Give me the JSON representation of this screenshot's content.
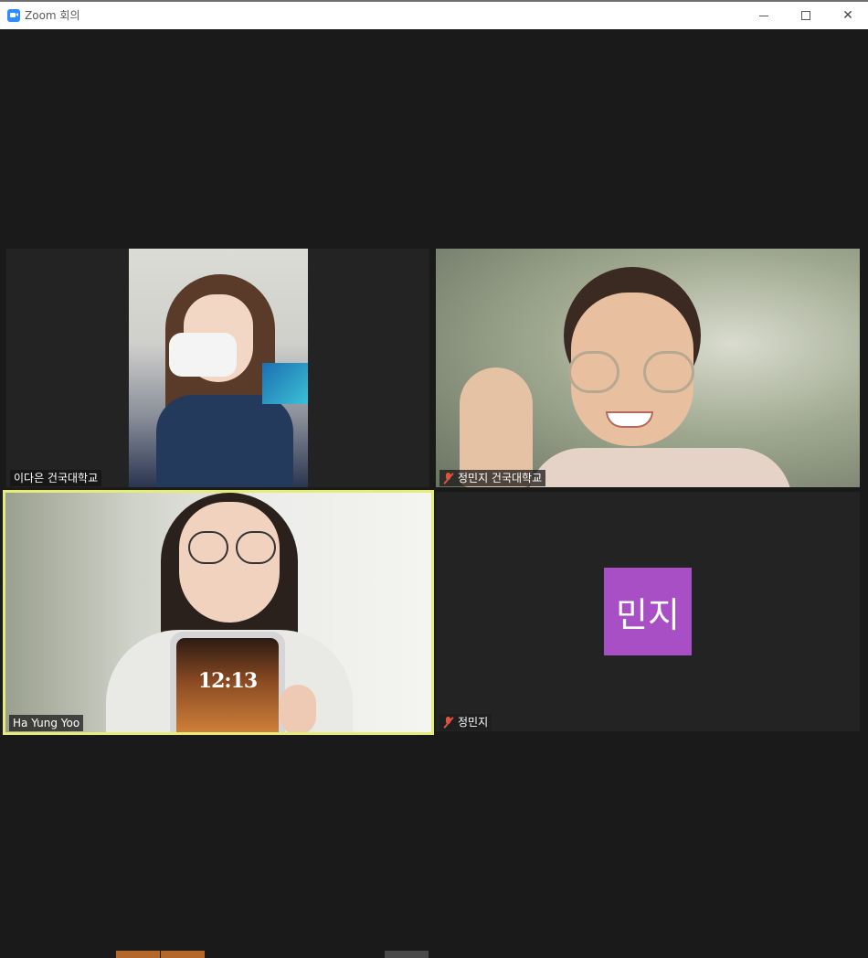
{
  "window": {
    "title": "Zoom 회의",
    "controls": {
      "minimize": "minimize",
      "maximize": "maximize",
      "close": "close"
    }
  },
  "participants": [
    {
      "name": "이다은 건국대학교",
      "muted": false,
      "video": true
    },
    {
      "name": "정민지 건국대학교",
      "muted": true,
      "video": true
    },
    {
      "name": "Ha Yung Yoo",
      "muted": false,
      "video": true,
      "active_speaker": true,
      "phone_time": "12:13"
    },
    {
      "name": "정민지",
      "muted": true,
      "video": false,
      "avatar_text": "민지",
      "avatar_color": "#a94fc5"
    }
  ],
  "colors": {
    "active_speaker_border": "#e6ec7a",
    "muted_icon": "#e0533f",
    "zoom_brand": "#2d8cff"
  }
}
